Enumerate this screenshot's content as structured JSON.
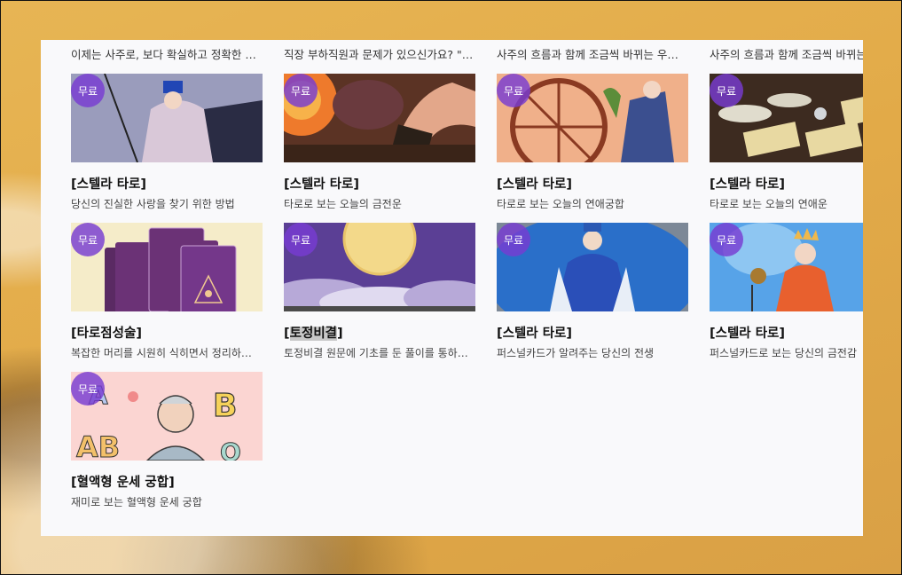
{
  "top_descriptions": [
    "이제는 사주로, 보다 확실하고 정확한 …",
    "직장 부하직원과 문제가 있으신가요? \"…",
    "사주의 흐름과 함께 조금씩 바뀌는 우천…",
    "사주의 흐름과 함께 조금씩 바뀌는 우천…"
  ],
  "badge_label": "무료",
  "cards": [
    {
      "title": "[스텔라 타로]",
      "desc": "당신의 진실한 사랑을 찾기 위한 방법",
      "image_icon": "tarot-knight-icon"
    },
    {
      "title": "[스텔라 타로]",
      "desc": "타로로 보는 오늘의 금전운",
      "image_icon": "card-reading-icon"
    },
    {
      "title": "[스텔라 타로]",
      "desc": "타로로 보는 오늘의 연애궁합",
      "image_icon": "wheel-of-fortune-icon"
    },
    {
      "title": "[스텔라 타로]",
      "desc": "타로로 보는 오늘의 연애운",
      "image_icon": "tarot-spread-icon"
    },
    {
      "title": "[타로점성술]",
      "desc": "복잡한 머리를 시원히 식히면서 정리하…",
      "image_icon": "tarot-deck-icon"
    },
    {
      "title_prefix": "[",
      "title_highlight": "토정비결",
      "title_suffix": "]",
      "desc": "토정비결 원문에 기초를 둔 풀이를 통하…",
      "image_icon": "full-moon-icon"
    },
    {
      "title": "[스텔라 타로]",
      "desc": "퍼스널카드가 알려주는 당신의 전생",
      "image_icon": "priestess-icon"
    },
    {
      "title": "[스텔라 타로]",
      "desc": "퍼스널카드로 보는 당신의 금전감",
      "image_icon": "queen-card-icon"
    },
    {
      "title": "[혈액형 운세 궁합]",
      "desc": "재미로 보는 혈액형 운세 궁합",
      "image_icon": "blood-type-icon"
    }
  ],
  "colors": {
    "badge": "#7a3cd2",
    "background": "#e3ad4c",
    "panel": "#f9f9fb"
  }
}
